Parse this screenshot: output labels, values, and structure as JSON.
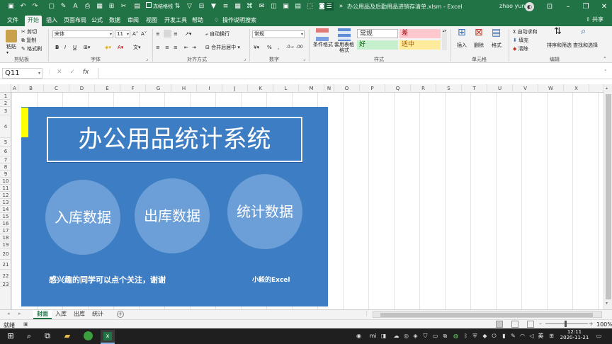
{
  "titlebar": {
    "document_title": "办公用品及后勤用品进销存清单.xlsm - Excel",
    "user_name": "zhao yun",
    "avatar_text": "◐",
    "quick_access": [
      "save-icon",
      "undo-icon",
      "redo-icon",
      "new-icon",
      "format-painter-icon",
      "font-color-icon",
      "print-icon",
      "border-icon",
      "insert-icon",
      "cut-icon",
      "filter-icon",
      "sort-icon",
      "camera-icon",
      "picture-icon",
      "macro-icon",
      "chart-icon",
      "web-icon",
      "screenshot-icon",
      "table-icon",
      "align-icon"
    ],
    "extra_label": "冻结格线"
  },
  "menu": {
    "tabs": [
      "文件",
      "开始",
      "插入",
      "页面布局",
      "公式",
      "数据",
      "审阅",
      "视图",
      "开发工具",
      "帮助"
    ],
    "active_tab": "开始",
    "tell_me": "操作说明搜索",
    "share": "共享"
  },
  "ribbon": {
    "clipboard": {
      "paste": "粘贴",
      "cut": "剪切",
      "copy": "复制",
      "format_painter": "格式刷",
      "label": "剪贴板"
    },
    "font": {
      "name": "宋体",
      "size": "11",
      "bold": "B",
      "italic": "I",
      "underline": "U",
      "label": "字体"
    },
    "alignment": {
      "wrap": "自动换行",
      "merge": "合并后居中",
      "label": "对齐方式"
    },
    "number": {
      "format": "常规",
      "percent": "%",
      "comma": ",",
      "label": "数字"
    },
    "styles": {
      "conditional": "条件格式",
      "table": "套用表格格式",
      "normal": "常规",
      "bad": "差",
      "good": "好",
      "neutral": "适中",
      "label": "样式"
    },
    "cells": {
      "insert": "插入",
      "delete": "删除",
      "format": "格式",
      "label": "单元格"
    },
    "editing": {
      "autosum": "自动求和",
      "fill": "填充",
      "clear": "清除",
      "sort": "排序和筛选",
      "find": "查找和选择",
      "label": "编辑"
    }
  },
  "formula_bar": {
    "name_box": "Q11",
    "fx": "fx",
    "formula": ""
  },
  "columns": [
    "A",
    "B",
    "C",
    "D",
    "E",
    "F",
    "G",
    "H",
    "I",
    "J",
    "K",
    "L",
    "M",
    "N",
    "O",
    "P",
    "Q",
    "R",
    "S",
    "T",
    "U",
    "V",
    "W",
    "X"
  ],
  "rows": [
    "1",
    "2",
    "3",
    "4",
    "5",
    "6",
    "7",
    "8",
    "9",
    "10",
    "11",
    "12",
    "13",
    "14",
    "15",
    "16",
    "17",
    "18",
    "19",
    "20",
    "21",
    "22",
    "23"
  ],
  "banner": {
    "title": "办公用品统计系统",
    "buttons": [
      "入库数据",
      "出库数据",
      "统计数据"
    ],
    "follow_text": "感兴趣的同学可以点个关注，谢谢",
    "author": "小毅的Excel"
  },
  "sheets": {
    "tabs": [
      "封面",
      "入库",
      "出库",
      "统计"
    ],
    "active": "封面"
  },
  "status": {
    "mode": "就绪",
    "zoom": "100%"
  },
  "taskbar": {
    "time": "12:11",
    "date": "2020-11-21",
    "ime": "英"
  },
  "colors": {
    "excel_green": "#217346",
    "banner_blue": "#3d7dc3",
    "circle_blue": "#6c9fd8",
    "yellow": "#ffff00"
  }
}
